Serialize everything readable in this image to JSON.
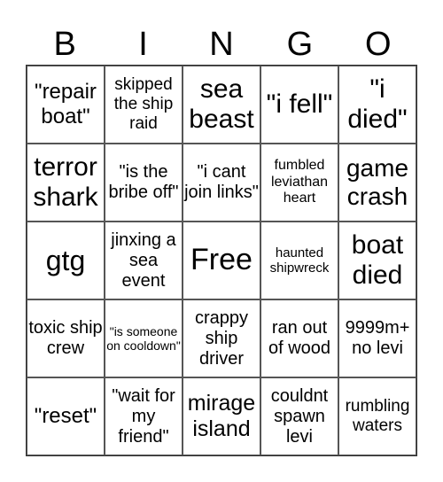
{
  "header": [
    "B",
    "I",
    "N",
    "G",
    "O"
  ],
  "cells": [
    "\"repair boat\"",
    "skipped the ship raid",
    "sea beast",
    "\"i fell\"",
    "\"i died\"",
    "terror shark",
    "\"is the bribe off\"",
    "\"i cant join links\"",
    "fumbled leviathan heart",
    "game crash",
    "gtg",
    "jinxing a sea event",
    "Free",
    "haunted shipwreck",
    "boat died",
    "toxic ship crew",
    "\"is someone on cooldown\"",
    "crappy ship driver",
    "ran out of wood",
    "9999m+ no levi",
    "\"reset\"",
    "\"wait for my friend\"",
    "mirage island",
    "couldnt spawn levi",
    "rumbling waters"
  ]
}
